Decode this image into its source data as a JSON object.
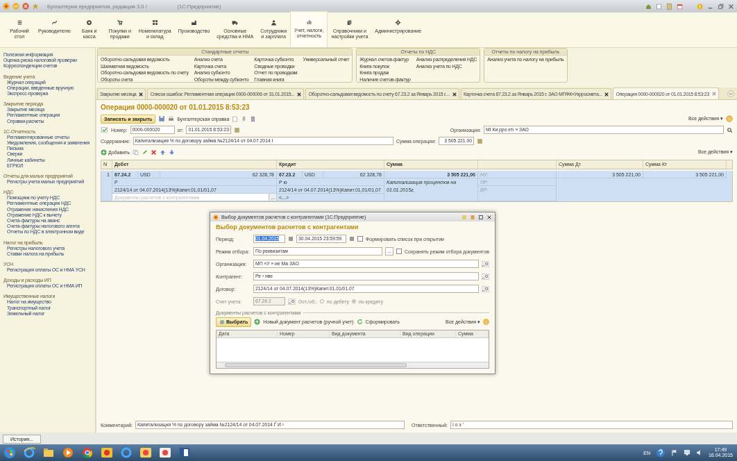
{
  "window": {
    "title": "Бухгалтерия предприятия, редакция 3.0 /",
    "title_suffix": "(1С:Предприятие)"
  },
  "sections": [
    {
      "label": "Рабочий\nстол",
      "selected": false
    },
    {
      "label": "Руководителю",
      "selected": false
    },
    {
      "label": "Банк и\nкасса",
      "selected": false
    },
    {
      "label": "Покупки и\nпродажи",
      "selected": false
    },
    {
      "label": "Номенклатура\nи склад",
      "selected": false
    },
    {
      "label": "Производство",
      "selected": false
    },
    {
      "label": "Основные\nсредства и НМА",
      "selected": false
    },
    {
      "label": "Сотрудники\nи зарплата",
      "selected": false
    },
    {
      "label": "Учет, налоги,\nотчетность",
      "selected": true
    },
    {
      "label": "Справочники и\nнастройки учета",
      "selected": false
    },
    {
      "label": "Администрирование",
      "selected": false
    }
  ],
  "sidebar": {
    "top_links": [
      "Полезная информация",
      "Оценка риска налоговой проверки",
      "Корреспонденции счетов"
    ],
    "groups": [
      {
        "title": "Ведение учета",
        "items": [
          "Журнал операций",
          "Операции, введенные вручную",
          "Экспресс-проверка"
        ]
      },
      {
        "title": "Закрытие периода",
        "items": [
          "Закрытие месяца",
          "Регламентные операции",
          "Справки-расчеты"
        ]
      },
      {
        "title": "1С-Отчетность",
        "items": [
          "Регламентированные отчеты",
          "Уведомления, сообщения и заявления",
          "Письма",
          "Сверки",
          "Личные кабинеты",
          "ЕГРЮЛ"
        ]
      },
      {
        "title": "Отчеты для малых предприятий",
        "items": [
          "Регистры учета малых предприятий"
        ]
      },
      {
        "title": "НДС",
        "items": [
          "Помощник по учету НДС",
          "Регламентные операции НДС",
          "Отражение начисления НДС",
          "Отражение НДС к вычету",
          "Счета-фактуры на аванс",
          "Счета-фактуры налогового агента",
          "Отчеты по НДС в электронном виде"
        ]
      },
      {
        "title": "Налог на прибыль",
        "items": [
          "Регистры налогового учета",
          "Ставки налога на прибыль"
        ]
      },
      {
        "title": "УСН",
        "items": [
          "Регистрация оплаты ОС и НМА УСН"
        ]
      },
      {
        "title": "Доходы и расходы ИП",
        "items": [
          "Регистрация оплаты ОС и НМА ИП"
        ]
      },
      {
        "title": "Имущественные налоги",
        "items": [
          "Налог на имущество",
          "Транспортный налог",
          "Земельный налог"
        ]
      }
    ]
  },
  "panels": [
    {
      "title": "Стандартные отчеты",
      "columns": [
        [
          "Оборотно-сальдовая ведомость",
          "Шахматная ведомость",
          "Оборотно-сальдовая ведомость по счету",
          "Обороты счета"
        ],
        [
          "Анализ счета",
          "Карточка счета",
          "Анализ субконто",
          "Обороты между субконто"
        ],
        [
          "Карточка субконто",
          "Сводные проводки",
          "Отчет по проводкам",
          "Главная книга"
        ],
        [
          "Универсальный отчет"
        ]
      ]
    },
    {
      "title": "Отчеты по НДС",
      "columns": [
        [
          "Журнал счетов-фактур",
          "Книга покупок",
          "Книга продаж",
          "Наличие счетов-фактур"
        ],
        [
          "Анализ распределения НДС",
          "Анализ учета по НДС"
        ]
      ]
    },
    {
      "title": "Отчеты по налогу на прибыль",
      "columns": [
        [
          "Анализ учета по налогу на прибыль"
        ]
      ]
    }
  ],
  "tabs": [
    {
      "label": "Закрытие месяца",
      "selected": false
    },
    {
      "label": "Список ошибок: Регламентная операция 0000-000006 от 31.01.2015...",
      "selected": false
    },
    {
      "label": "Оборотно-сальдовая ведомость по счету 67.23.2 за Январь 2015 г....",
      "selected": false
    },
    {
      "label": "Карточка счета 67.23.2 за Январь 2015 г. ЗАО МПФК«Укрросмета...",
      "selected": false
    },
    {
      "label": "Операция 0000-000020 от 01.01.2015 8:53:23",
      "selected": true
    }
  ],
  "form": {
    "title": "Операция 0000-000020 от 01.01.2015 8:53:23",
    "save_close": "Записать и закрыть",
    "print": "Бухгалтерская справка",
    "all_actions": "Все действия ▾",
    "number_label": "Номер:",
    "number": "0000-000020",
    "date_label": "от:",
    "date": "01.01.2015  8:53:23",
    "org_label": "Организация:",
    "org": "МІ   Ки   рро   еті   » ЗАО",
    "content_label": "Содержание:",
    "content": "Капитализация  % по договору займа  №2124/14 от 04.07.2014 І",
    "amount_label": "Сумма операции:",
    "amount": "3 505 221.00",
    "add": "Добавить",
    "table_actions": "Все действия ▾"
  },
  "table": {
    "columns": [
      "N",
      "Дебет",
      "Кредит",
      "Сумма",
      "Сумма Дт",
      "Сумма Кт"
    ],
    "rows": [
      {
        "selected": true,
        "n": "1",
        "debit": {
          "account": "67.24.2",
          "currency": "USD",
          "amount": "62 328,78",
          "subconto": "Р",
          "contract": "2124/14 от 04.07.2014(13%)Капит.01,01/01,07",
          "documents_placeholder": "Документы расчетов с контрагентами",
          "documents_button": "..."
        },
        "credit": {
          "account": "67.23.2",
          "currency": "USD",
          "amount": "62 328,78",
          "subconto": "Р    ю",
          "contract": "2124/14 от 04.07.2014(13%)Капит.01,01/01,07",
          "documents": "<...>"
        },
        "sum": "3 505 221,00",
        "sum_comment": "Капитализация  процентов на 01.01.2015г.",
        "tax_labels": [
          "НУ:",
          "ПР:",
          "ВР:"
        ],
        "sum_dt": "3 505 221,00",
        "sum_kt": "3 505 221,00"
      }
    ]
  },
  "footer": {
    "comment_label": "Комментарий:",
    "comment": "Капитализация  % по договору займа  №2124/14 от 04.07.2014 Ґ   И   ›",
    "responsible_label": "Ответственный:",
    "responsible": "І   о   з   ’"
  },
  "history_button": "История...",
  "dialog": {
    "title": "Выбор документов расчетов с контрагентами  (1С:Предприятие)",
    "heading": "Выбор документов расчетов с контрагентами",
    "period_label": "Период:",
    "period_from": "01.04.2015",
    "period_from_highlighted": true,
    "period_to": "30.04.2015 23:59:59",
    "auto_build": {
      "label": "Формировать список при открытии",
      "checked": false
    },
    "filter_label": "Режим отбора:",
    "filter_value": "По реквизитам",
    "filter_button": "...",
    "save_mode": {
      "label": "Сохранять режим отбора документов",
      "checked": false
    },
    "fields": [
      {
        "label": "Организация:",
        "value": "МП   «У   »   ие   Ma  ЗАО"
      },
      {
        "label": "Контрагент:",
        "value": "Ре   ›   нве"
      },
      {
        "label": "Договор:",
        "value": "2124/14 от 04.07.2014(13%)Капит.01.01/01.07"
      }
    ],
    "account": {
      "label": "Счет учета:",
      "value": "67.24.2",
      "disabled": true
    },
    "balance_label": "Ост./об.:",
    "balance_options": [
      {
        "label": "по дебету",
        "selected": false
      },
      {
        "label": "по кредиту",
        "selected": true
      }
    ],
    "group_title": "Документы расчетов с контрагентами",
    "select": "Выбрать",
    "new_doc": "Новый документ расчетов (ручной учет)",
    "build": "Сформировать",
    "all_actions": "Все действия ▾",
    "columns": [
      "Дата",
      "Номер",
      "Вид документа",
      "Вид операции",
      "Сумма"
    ]
  },
  "taskbar": {
    "lang": "EN",
    "time": "17:49",
    "date": "16.04.2015"
  }
}
